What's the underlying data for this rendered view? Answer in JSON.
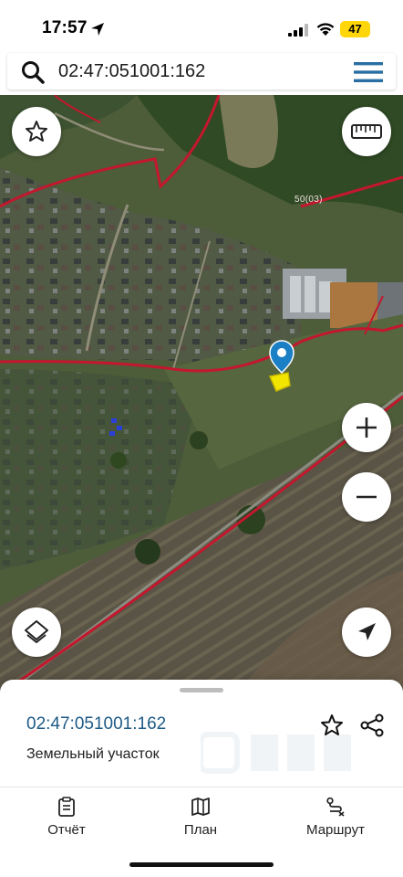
{
  "status_bar": {
    "time": "17:57",
    "battery": "47",
    "battery_color": "#ffd60a"
  },
  "search": {
    "value": "02:47:051001:162",
    "icon": "search-icon",
    "menu_icon": "hamburger-menu-icon"
  },
  "map": {
    "labels": {
      "road_code": "50(03)"
    },
    "boundary_color": "#c4172e",
    "marker_color": "#1a7fc4",
    "parcel_color": "#f2e600",
    "buttons": [
      {
        "name": "favorite",
        "icon": "star-icon"
      },
      {
        "name": "ruler",
        "icon": "ruler-icon"
      },
      {
        "name": "zoom-in",
        "icon": "plus-icon"
      },
      {
        "name": "zoom-out",
        "icon": "minus-icon"
      },
      {
        "name": "layers",
        "icon": "layers-icon"
      },
      {
        "name": "my-location",
        "icon": "navigation-arrow-icon"
      }
    ]
  },
  "panel": {
    "parcel_number": "02:47:051001:162",
    "parcel_type": "Земельный участок",
    "accent_color": "#1d5a86"
  },
  "nav": {
    "items": [
      {
        "label": "Отчёт",
        "icon": "report-icon"
      },
      {
        "label": "План",
        "icon": "map-plan-icon"
      },
      {
        "label": "Маршрут",
        "icon": "route-icon"
      }
    ]
  }
}
